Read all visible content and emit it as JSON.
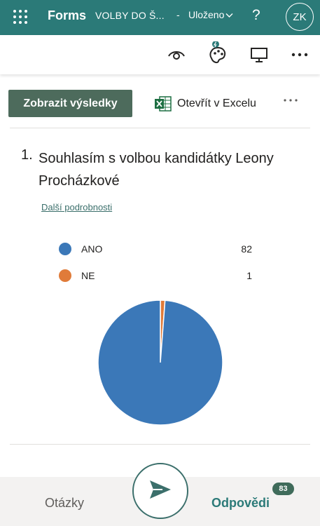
{
  "header": {
    "app_name": "Forms",
    "form_title": "VOLBY DO Š...",
    "separator": "-",
    "save_status": "Uloženo",
    "help_label": "?",
    "avatar_initials": "ZK",
    "icons": {
      "app_launcher": "waffle-icon",
      "save_menu": "chevron-down-icon"
    }
  },
  "toolbar": {
    "icons": [
      "eye-icon",
      "palette-icon",
      "presentation-icon",
      "more-icon"
    ]
  },
  "actions": {
    "view_results_label": "Zobrazit výsledky",
    "open_excel_label": "Otevřít v Excelu",
    "more_label": "···"
  },
  "question": {
    "number": "1.",
    "text": "Souhlasím s volbou kandidátky Leony Procházkové",
    "details_link": "Další podrobnosti"
  },
  "chart_data": {
    "type": "pie",
    "categories": [
      "ANO",
      "NE"
    ],
    "values": [
      82,
      1
    ],
    "colors": [
      "#3b78b8",
      "#e07b39"
    ],
    "legend_position": "top"
  },
  "bottom_nav": {
    "questions_tab": "Otázky",
    "responses_tab": "Odpovědi",
    "responses_count": "83",
    "send_icon": "send-icon"
  },
  "colors": {
    "brand": "#2b7a78",
    "primary_button": "#4d6b5c",
    "excel_green": "#1d6f42"
  }
}
